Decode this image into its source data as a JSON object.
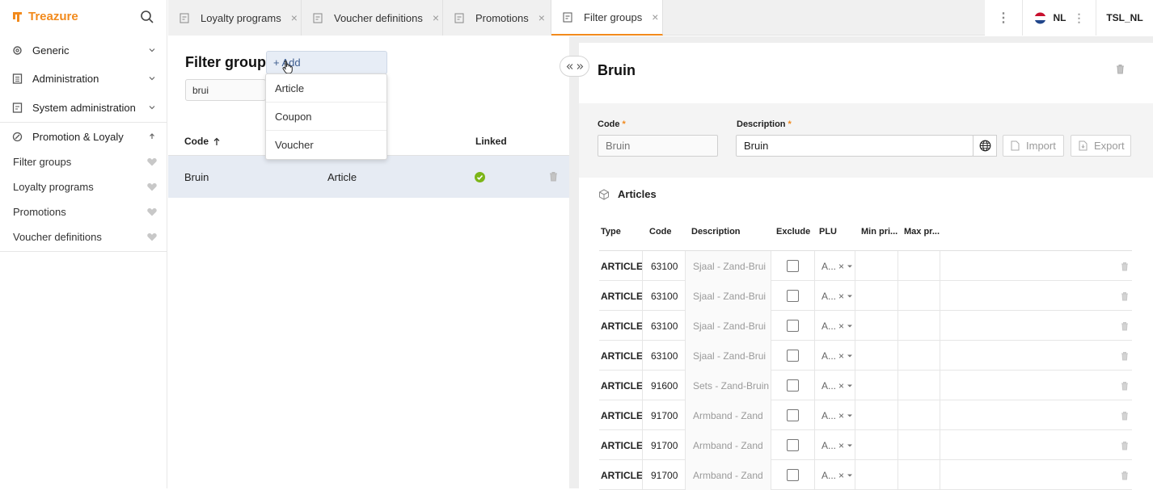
{
  "brand": {
    "name": "Treazure",
    "accent": "#f28a1c"
  },
  "sidebar": {
    "menu": [
      {
        "label": "Generic",
        "icon": "gear-icon",
        "expanded": false
      },
      {
        "label": "Administration",
        "icon": "document-icon",
        "expanded": false
      },
      {
        "label": "System administration",
        "icon": "system-admin-icon",
        "expanded": false
      },
      {
        "label": "Promotion & Loyaly",
        "icon": "promotion-icon",
        "expanded": true
      }
    ],
    "sub_items": [
      {
        "label": "Filter groups"
      },
      {
        "label": "Loyalty programs"
      },
      {
        "label": "Promotions"
      },
      {
        "label": "Voucher definitions"
      }
    ]
  },
  "tabs": [
    {
      "label": "Loyalty programs",
      "active": false
    },
    {
      "label": "Voucher definitions",
      "active": false
    },
    {
      "label": "Promotions",
      "active": false
    },
    {
      "label": "Filter groups",
      "active": true
    }
  ],
  "topbar": {
    "language": "NL",
    "user": "TSL_NL"
  },
  "list": {
    "title": "Filter group",
    "add_label": "+ Add",
    "search_value": "brui",
    "add_menu": [
      "Article",
      "Coupon",
      "Voucher"
    ],
    "columns": {
      "code": "Code",
      "linked": "Linked"
    },
    "rows": [
      {
        "code": "Bruin",
        "type": "Article",
        "linked": true
      }
    ]
  },
  "detail": {
    "title": "Bruin",
    "code_label": "Code",
    "code_placeholder": "Bruin",
    "description_label": "Description",
    "description_value": "Bruin",
    "import_label": "Import",
    "export_label": "Export",
    "section_title": "Articles",
    "columns": [
      "Type",
      "Code",
      "Description",
      "Exclude",
      "PLU",
      "Min pri...",
      "Max pr..."
    ],
    "rows": [
      {
        "type": "ARTICLE",
        "code": "63100",
        "description": "Sjaal - Zand-Brui",
        "plu": "A..."
      },
      {
        "type": "ARTICLE",
        "code": "63100",
        "description": "Sjaal - Zand-Brui",
        "plu": "A..."
      },
      {
        "type": "ARTICLE",
        "code": "63100",
        "description": "Sjaal - Zand-Brui",
        "plu": "A..."
      },
      {
        "type": "ARTICLE",
        "code": "63100",
        "description": "Sjaal - Zand-Brui",
        "plu": "A..."
      },
      {
        "type": "ARTICLE",
        "code": "91600",
        "description": "Sets - Zand-Bruin",
        "plu": "A..."
      },
      {
        "type": "ARTICLE",
        "code": "91700",
        "description": "Armband - Zand",
        "plu": "A..."
      },
      {
        "type": "ARTICLE",
        "code": "91700",
        "description": "Armband - Zand",
        "plu": "A..."
      },
      {
        "type": "ARTICLE",
        "code": "91700",
        "description": "Armband - Zand",
        "plu": "A..."
      }
    ]
  }
}
